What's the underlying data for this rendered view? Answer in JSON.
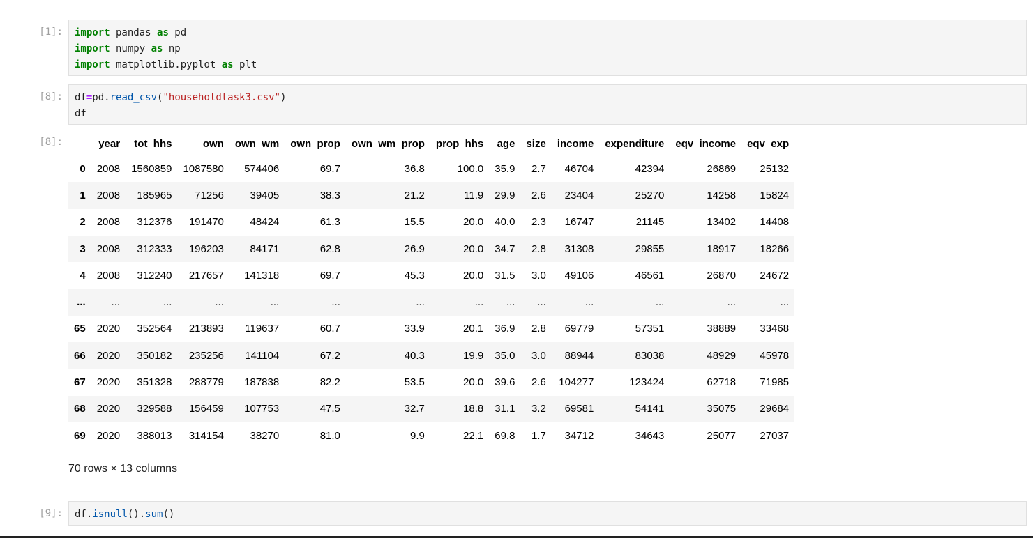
{
  "cells": [
    {
      "prompt": "[1]:",
      "lines": [
        [
          {
            "t": "import",
            "c": "kw"
          },
          {
            "t": " pandas ",
            "c": ""
          },
          {
            "t": "as",
            "c": "kw"
          },
          {
            "t": " pd",
            "c": ""
          }
        ],
        [
          {
            "t": "import",
            "c": "kw"
          },
          {
            "t": " numpy ",
            "c": ""
          },
          {
            "t": "as",
            "c": "kw"
          },
          {
            "t": " np",
            "c": ""
          }
        ],
        [
          {
            "t": "import",
            "c": "kw"
          },
          {
            "t": " matplotlib.pyplot ",
            "c": ""
          },
          {
            "t": "as",
            "c": "kw"
          },
          {
            "t": " plt",
            "c": ""
          }
        ]
      ]
    },
    {
      "prompt": "[8]:",
      "lines": [
        [
          {
            "t": "df",
            "c": ""
          },
          {
            "t": "=",
            "c": "op"
          },
          {
            "t": "pd.",
            "c": ""
          },
          {
            "t": "read_csv",
            "c": "fn"
          },
          {
            "t": "(",
            "c": ""
          },
          {
            "t": "\"householdtask3.csv\"",
            "c": "str"
          },
          {
            "t": ")",
            "c": ""
          }
        ],
        [
          {
            "t": "df",
            "c": ""
          }
        ]
      ]
    },
    {
      "prompt": "[9]:",
      "lines": [
        [
          {
            "t": "df.",
            "c": ""
          },
          {
            "t": "isnull",
            "c": "fn"
          },
          {
            "t": "().",
            "c": ""
          },
          {
            "t": "sum",
            "c": "fn"
          },
          {
            "t": "()",
            "c": ""
          }
        ]
      ]
    }
  ],
  "output": {
    "prompt": "[8]:",
    "columns": [
      "",
      "year",
      "tot_hhs",
      "own",
      "own_wm",
      "own_prop",
      "own_wm_prop",
      "prop_hhs",
      "age",
      "size",
      "income",
      "expenditure",
      "eqv_income",
      "eqv_exp"
    ],
    "rows": [
      [
        "0",
        "2008",
        "1560859",
        "1087580",
        "574406",
        "69.7",
        "36.8",
        "100.0",
        "35.9",
        "2.7",
        "46704",
        "42394",
        "26869",
        "25132"
      ],
      [
        "1",
        "2008",
        "185965",
        "71256",
        "39405",
        "38.3",
        "21.2",
        "11.9",
        "29.9",
        "2.6",
        "23404",
        "25270",
        "14258",
        "15824"
      ],
      [
        "2",
        "2008",
        "312376",
        "191470",
        "48424",
        "61.3",
        "15.5",
        "20.0",
        "40.0",
        "2.3",
        "16747",
        "21145",
        "13402",
        "14408"
      ],
      [
        "3",
        "2008",
        "312333",
        "196203",
        "84171",
        "62.8",
        "26.9",
        "20.0",
        "34.7",
        "2.8",
        "31308",
        "29855",
        "18917",
        "18266"
      ],
      [
        "4",
        "2008",
        "312240",
        "217657",
        "141318",
        "69.7",
        "45.3",
        "20.0",
        "31.5",
        "3.0",
        "49106",
        "46561",
        "26870",
        "24672"
      ],
      [
        "...",
        "...",
        "...",
        "...",
        "...",
        "...",
        "...",
        "...",
        "...",
        "...",
        "...",
        "...",
        "...",
        "..."
      ],
      [
        "65",
        "2020",
        "352564",
        "213893",
        "119637",
        "60.7",
        "33.9",
        "20.1",
        "36.9",
        "2.8",
        "69779",
        "57351",
        "38889",
        "33468"
      ],
      [
        "66",
        "2020",
        "350182",
        "235256",
        "141104",
        "67.2",
        "40.3",
        "19.9",
        "35.0",
        "3.0",
        "88944",
        "83038",
        "48929",
        "45978"
      ],
      [
        "67",
        "2020",
        "351328",
        "288779",
        "187838",
        "82.2",
        "53.5",
        "20.0",
        "39.6",
        "2.6",
        "104277",
        "123424",
        "62718",
        "71985"
      ],
      [
        "68",
        "2020",
        "329588",
        "156459",
        "107753",
        "47.5",
        "32.7",
        "18.8",
        "31.1",
        "3.2",
        "69581",
        "54141",
        "35075",
        "29684"
      ],
      [
        "69",
        "2020",
        "388013",
        "314154",
        "38270",
        "81.0",
        "9.9",
        "22.1",
        "69.8",
        "1.7",
        "34712",
        "34643",
        "25077",
        "27037"
      ]
    ],
    "shape_text": "70 rows × 13 columns"
  }
}
